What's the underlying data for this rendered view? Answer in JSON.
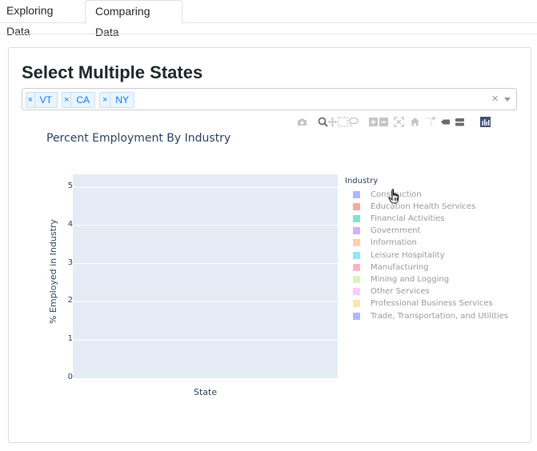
{
  "tabs": [
    {
      "label": "Exploring Data",
      "active": false
    },
    {
      "label": "Comparing Data",
      "active": true
    }
  ],
  "heading": "Select Multiple States",
  "select": {
    "remove_glyph": "×",
    "chips": [
      "VT",
      "CA",
      "NY"
    ],
    "clear_glyph": "×"
  },
  "modebar": {
    "icons": [
      "camera-icon",
      "zoom-icon",
      "pan-icon",
      "box-select-icon",
      "lasso-icon",
      "zoom-in-icon",
      "zoom-out-icon",
      "autoscale-icon",
      "reset-axes-icon",
      "spike-lines-icon",
      "hover-closest-icon",
      "hover-compare-icon",
      "plotly-logo-icon"
    ]
  },
  "chart_data": {
    "type": "bar",
    "title": "Percent Employment By Industry",
    "xlabel": "State",
    "ylabel": "% Employed in Industry",
    "categories": [],
    "ylim": [
      0,
      5
    ],
    "yticks": [
      "0",
      "1",
      "2",
      "3",
      "4",
      "5"
    ],
    "grid": true,
    "legend": {
      "title": "Industry",
      "placement": "right",
      "entries": [
        {
          "name": "Construction",
          "color": "#636efa"
        },
        {
          "name": "Education  Health Services",
          "color": "#ef553b"
        },
        {
          "name": "Financial Activities",
          "color": "#00cc96"
        },
        {
          "name": "Government",
          "color": "#ab63fa"
        },
        {
          "name": "Information",
          "color": "#ffa15a"
        },
        {
          "name": "Leisure  Hospitality",
          "color": "#19d3f3"
        },
        {
          "name": "Manufacturing",
          "color": "#ff6692"
        },
        {
          "name": "Mining and Logging",
          "color": "#b6e880"
        },
        {
          "name": "Other Services",
          "color": "#ff97ff"
        },
        {
          "name": "Professional  Business Services",
          "color": "#fecb52"
        },
        {
          "name": "Trade, Transportation, and Utilities",
          "color": "#636efa"
        }
      ]
    },
    "plot_bg": "#e5ecf6"
  }
}
